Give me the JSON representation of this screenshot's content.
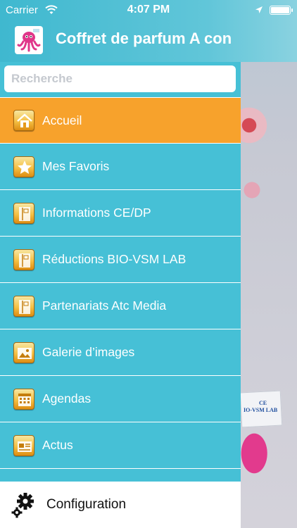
{
  "status_bar": {
    "carrier": "Carrier",
    "time": "4:07 PM"
  },
  "header": {
    "title": "Coffret de parfum A con",
    "logo_icon": "octopus-mascot-logo"
  },
  "search": {
    "placeholder": "Recherche",
    "value": ""
  },
  "menu": {
    "items": [
      {
        "label": "Accueil",
        "icon": "home-icon",
        "active": true
      },
      {
        "label": "Mes Favoris",
        "icon": "star-icon",
        "active": false
      },
      {
        "label": "Informations CE/DP",
        "icon": "book-icon",
        "active": false
      },
      {
        "label": "Réductions BIO-VSM LAB",
        "icon": "book-icon",
        "active": false
      },
      {
        "label": "Partenariats Atc Media",
        "icon": "book-icon",
        "active": false
      },
      {
        "label": "Galerie d’images",
        "icon": "gallery-icon",
        "active": false
      },
      {
        "label": "Agendas",
        "icon": "calendar-icon",
        "active": false
      },
      {
        "label": "Actus",
        "icon": "news-icon",
        "active": false
      }
    ]
  },
  "config": {
    "label": "Configuration",
    "icon": "gear-icon"
  },
  "background_card": {
    "line1": "CE",
    "line2": "IO-VSM LAB"
  },
  "colors": {
    "drawer": "#46c0d6",
    "active_item": "#f7a22c",
    "header": "#3fb8cf"
  }
}
